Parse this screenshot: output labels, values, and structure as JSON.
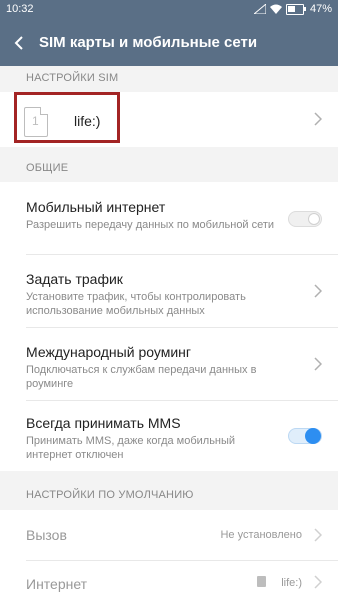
{
  "status_bar": {
    "time": "10:32",
    "battery": "47%",
    "battery_fraction": 0.47
  },
  "app_bar": {
    "title": "SIM карты и мобильные сети",
    "back_icon": "chevron-left-icon"
  },
  "sections": {
    "sim_settings_header": "НАСТРОЙКИ SIM",
    "general_header": "ОБЩИЕ",
    "defaults_header": "НАСТРОЙКИ ПО УМОЛЧАНИЮ"
  },
  "sim": {
    "slot_number": "1",
    "name": "life:)"
  },
  "general": {
    "mobile_internet": {
      "title": "Мобильный интернет",
      "subtitle": "Разрешить передачу данных по мобильной сети",
      "enabled": false
    },
    "set_traffic": {
      "title": "Задать трафик",
      "subtitle": "Установите трафик, чтобы контролировать использование мобильных данных"
    },
    "roaming": {
      "title": "Международный роуминг",
      "subtitle": "Подключаться к службам передачи данных в роуминге"
    },
    "mms": {
      "title": "Всегда принимать MMS",
      "subtitle": "Принимать MMS, даже когда мобильный интернет отключен",
      "enabled": true
    }
  },
  "defaults": {
    "calls": {
      "title": "Вызов",
      "value": "Не установлено"
    },
    "internet": {
      "title": "Интернет",
      "value": "life:)",
      "sim_slot": "1"
    }
  },
  "colors": {
    "accent": "#2d8ef1",
    "app_bar": "#5a6f86",
    "highlight": "#a32424"
  }
}
